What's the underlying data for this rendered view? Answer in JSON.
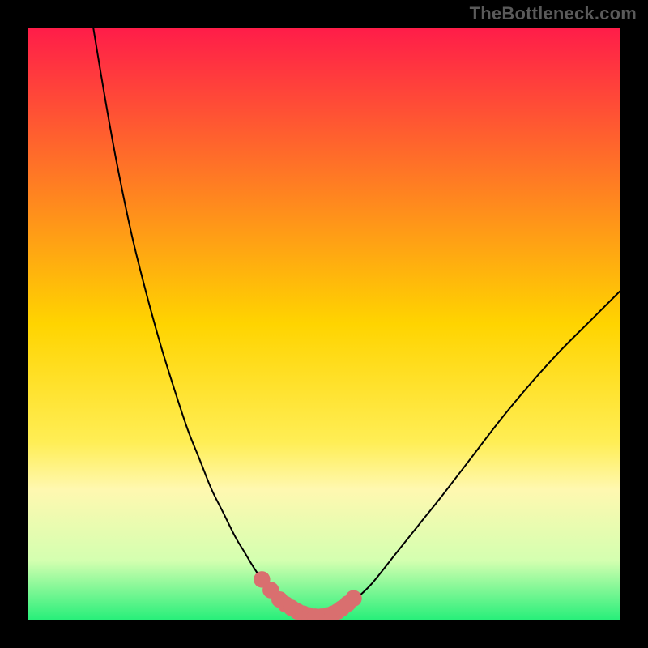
{
  "watermark": {
    "text": "TheBottleneck.com"
  },
  "chart_data": {
    "type": "line",
    "title": "",
    "xlabel": "",
    "ylabel": "",
    "xlim": [
      0,
      100
    ],
    "ylim": [
      0,
      100
    ],
    "gradient_stops": [
      {
        "offset": 0.0,
        "color": "#ff1d49"
      },
      {
        "offset": 0.5,
        "color": "#ffd400"
      },
      {
        "offset": 0.7,
        "color": "#ffee55"
      },
      {
        "offset": 0.78,
        "color": "#fff8b0"
      },
      {
        "offset": 0.9,
        "color": "#d4ffb0"
      },
      {
        "offset": 1.0,
        "color": "#28ef7a"
      }
    ],
    "series": [
      {
        "name": "bottleneck-curve",
        "x": [
          11.0,
          13.0,
          15.0,
          17.5,
          20.0,
          22.5,
          25.0,
          27.0,
          29.0,
          31.0,
          33.0,
          35.0,
          36.5,
          38.0,
          39.5,
          41.0,
          42.5,
          44.0,
          45.5,
          47.0,
          48.5,
          50.0,
          51.5,
          53.0,
          55.0,
          58.0,
          62.0,
          66.0,
          70.0,
          75.0,
          80.0,
          85.0,
          90.0,
          95.0,
          100.0
        ],
        "y": [
          100.0,
          88.0,
          77.0,
          65.0,
          55.0,
          46.0,
          38.0,
          32.0,
          27.0,
          22.0,
          18.0,
          14.0,
          11.5,
          9.0,
          6.8,
          5.0,
          3.5,
          2.3,
          1.3,
          0.7,
          0.4,
          0.6,
          1.0,
          1.8,
          3.2,
          6.0,
          11.0,
          16.0,
          21.0,
          27.5,
          34.0,
          40.0,
          45.5,
          50.5,
          55.5
        ]
      }
    ],
    "highlight_points": {
      "x": [
        39.5,
        41.0,
        42.5,
        43.5,
        44.5,
        45.5,
        46.5,
        47.5,
        48.5,
        49.5,
        50.5,
        51.5,
        52.3,
        53.0,
        54.0,
        55.0
      ],
      "y": [
        6.8,
        5.0,
        3.4,
        2.6,
        2.0,
        1.4,
        1.0,
        0.7,
        0.5,
        0.5,
        0.7,
        1.0,
        1.4,
        1.9,
        2.7,
        3.6
      ],
      "color": "#d96f6f",
      "radius": 1.4
    }
  }
}
